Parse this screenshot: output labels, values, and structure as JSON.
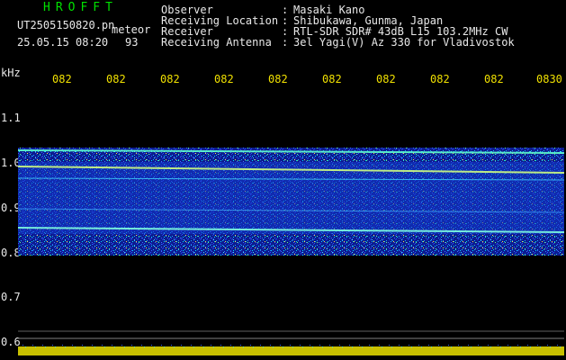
{
  "header": {
    "app_title": "HROFFT",
    "filename": "UT2505150820.pn",
    "meteor_label": "meteor",
    "datetime": "25.05.15 08:20",
    "count": "93",
    "info": [
      {
        "label": "Observer",
        "value": "Masaki Kano"
      },
      {
        "label": "Receiving Location",
        "value": "Shibukawa, Gunma, Japan"
      },
      {
        "label": "Receiver",
        "value": "RTL-SDR SDR# 43dB L15 103.2MHz CW"
      },
      {
        "label": "Receiving Antenna",
        "value": "3el Yagi(V) Az 330 for Vladivostok"
      }
    ]
  },
  "axis": {
    "unit_label": "kHz",
    "time_ticks": [
      "082",
      "082",
      "082",
      "082",
      "082",
      "082",
      "082",
      "082",
      "082",
      "0830"
    ],
    "freq_ticks": [
      "1.1",
      "1.0",
      "0.9",
      "0.8",
      "0.7",
      "0.6"
    ]
  },
  "colors": {
    "background": "#000000",
    "title_green": "#00e000",
    "tick_yellow": "#f0e000",
    "text_white": "#e8e8e8",
    "noise_blue": "#1030d0",
    "power_bar_yellow": "#e8e000"
  }
}
